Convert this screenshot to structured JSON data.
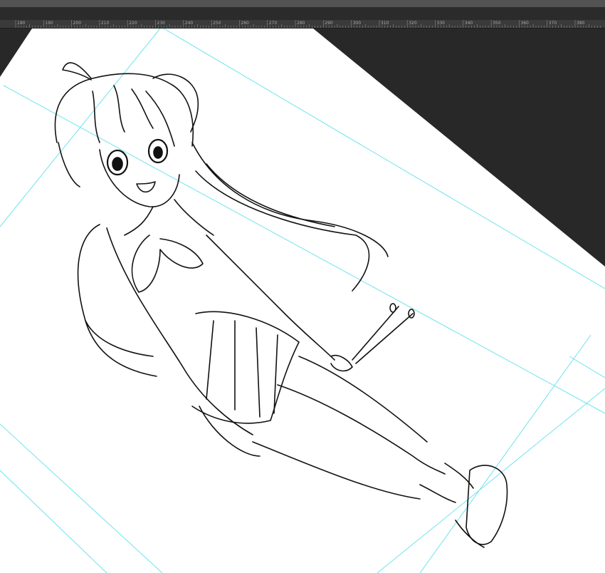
{
  "app": {
    "accent_guide_color": "#6fe3f0",
    "pasteboard_color": "#282828",
    "ruler_color": "#3a3a3a"
  },
  "ruler": {
    "labels": [
      "180",
      "190",
      "200",
      "210",
      "220",
      "230",
      "240",
      "250",
      "260",
      "270",
      "280",
      "290",
      "300",
      "310",
      "320",
      "330",
      "340",
      "350",
      "360",
      "370",
      "380"
    ]
  },
  "artwork": {
    "subject": "anime-girl-lineart",
    "props": [
      "drumsticks"
    ]
  }
}
